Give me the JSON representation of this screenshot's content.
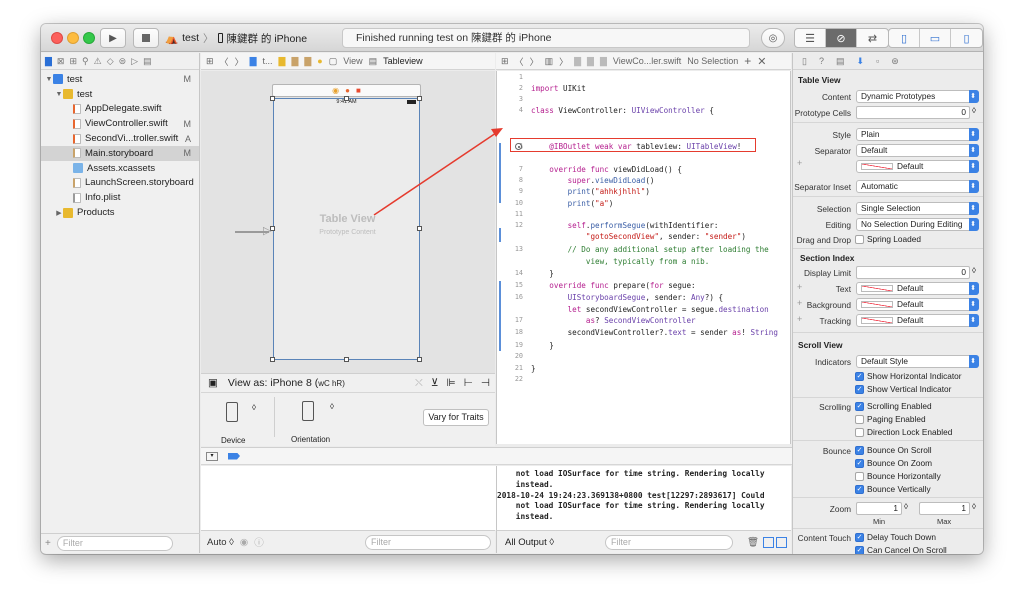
{
  "toolbar": {
    "scheme_target": "test",
    "scheme_device": "陳鍵群 的 iPhone",
    "status": "Finished running test on 陳鍵群 的 iPhone"
  },
  "navigator": {
    "items": [
      {
        "label": "test",
        "mark": "M",
        "level": 0,
        "kind": "project"
      },
      {
        "label": "test",
        "mark": "",
        "level": 1,
        "kind": "folder"
      },
      {
        "label": "AppDelegate.swift",
        "mark": "",
        "level": 2,
        "kind": "swift"
      },
      {
        "label": "ViewController.swift",
        "mark": "M",
        "level": 2,
        "kind": "swift"
      },
      {
        "label": "SecondVi...troller.swift",
        "mark": "A",
        "level": 2,
        "kind": "swift"
      },
      {
        "label": "Main.storyboard",
        "mark": "M",
        "level": 2,
        "kind": "storyboard",
        "selected": true
      },
      {
        "label": "Assets.xcassets",
        "mark": "",
        "level": 2,
        "kind": "assets"
      },
      {
        "label": "LaunchScreen.storyboard",
        "mark": "",
        "level": 2,
        "kind": "storyboard"
      },
      {
        "label": "Info.plist",
        "mark": "",
        "level": 2,
        "kind": "plist"
      },
      {
        "label": "Products",
        "mark": "",
        "level": 1,
        "kind": "folder-closed"
      }
    ],
    "filter_placeholder": "Filter"
  },
  "ib": {
    "jump_t": "t...",
    "jump_view": "View",
    "jump_tableview": "Tableview",
    "status_time": "9:41 AM",
    "table_view_title": "Table View",
    "table_view_subtitle": "Prototype Content",
    "view_as": "View as: iPhone 8 (",
    "view_as_suffix": "wC hR)",
    "device_label": "Device",
    "orientation_label": "Orientation",
    "vary_button": "Vary for Traits",
    "auto_label": "Auto ◊",
    "filter_placeholder": "Filter"
  },
  "editor": {
    "jump_file": "ViewCo...ler.swift",
    "jump_selection": "No Selection",
    "line_numbers": [
      "1",
      "2",
      "3",
      "4",
      "5",
      "6",
      "7",
      "8",
      "9",
      "10",
      "11",
      "12",
      "",
      "13",
      "",
      "14",
      "15",
      "16",
      "",
      "17",
      "18",
      "19",
      "20",
      "21",
      "22"
    ],
    "annot_line": "@IBOutlet weak var tableview: UITableView!"
  },
  "console": {
    "lines": [
      "    not load IOSurface for time string. Rendering locally",
      "    instead.",
      "2018-10-24 19:24:23.369138+0800 test[12297:2893617] Could",
      "    not load IOSurface for time string. Rendering locally",
      "    instead."
    ],
    "output_label": "All Output ◊",
    "filter_placeholder": "Filter"
  },
  "inspector": {
    "table_view_header": "Table View",
    "content_label": "Content",
    "content_value": "Dynamic Prototypes",
    "prototype_label": "Prototype Cells",
    "prototype_value": "0",
    "style_label": "Style",
    "style_value": "Plain",
    "separator_label": "Separator",
    "separator_value": "Default",
    "separator_color": "Default",
    "separator_inset_label": "Separator Inset",
    "separator_inset_value": "Automatic",
    "selection_label": "Selection",
    "selection_value": "Single Selection",
    "editing_label": "Editing",
    "editing_value": "No Selection During Editing",
    "dragdrop_label": "Drag and Drop",
    "spring_loaded": "Spring Loaded",
    "section_index_header": "Section Index",
    "display_limit_label": "Display Limit",
    "display_limit_value": "0",
    "text_label": "Text",
    "text_value": "Default",
    "background_label": "Background",
    "background_value": "Default",
    "tracking_label": "Tracking",
    "tracking_value": "Default",
    "scroll_view_header": "Scroll View",
    "indicators_label": "Indicators",
    "indicators_value": "Default Style",
    "show_h": "Show Horizontal Indicator",
    "show_v": "Show Vertical Indicator",
    "scrolling_label": "Scrolling",
    "scrolling_enabled": "Scrolling Enabled",
    "paging_enabled": "Paging Enabled",
    "direction_lock": "Direction Lock Enabled",
    "bounce_label": "Bounce",
    "bounce_on_scroll": "Bounce On Scroll",
    "bounce_on_zoom": "Bounce On Zoom",
    "bounce_h": "Bounce Horizontally",
    "bounce_v": "Bounce Vertically",
    "zoom_label": "Zoom",
    "zoom_min": "1",
    "zoom_max": "1",
    "min_label": "Min",
    "max_label": "Max",
    "content_touch_label": "Content Touch",
    "delay_touch": "Delay Touch Down",
    "can_cancel": "Can Cancel On Scroll"
  },
  "colors": {
    "accent": "#3b82e5",
    "annotation": "#e53b2e"
  }
}
